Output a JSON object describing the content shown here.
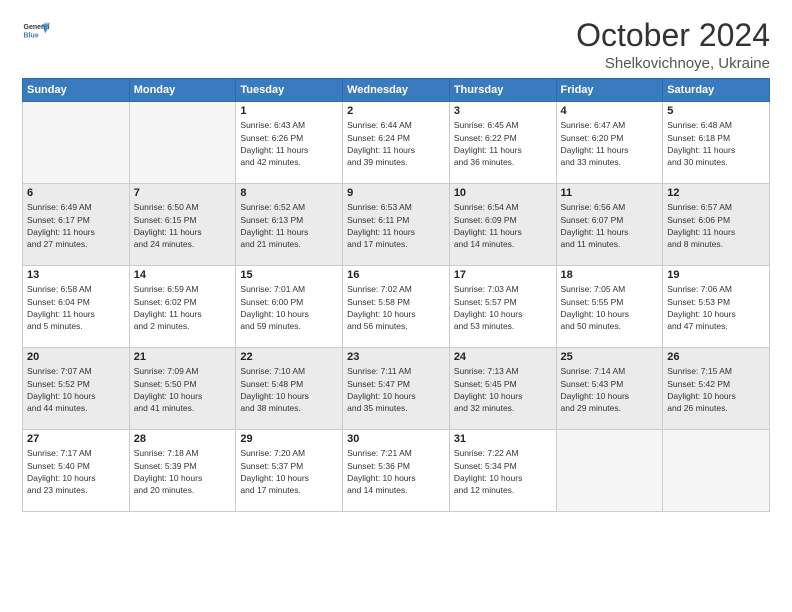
{
  "header": {
    "logo_line1": "General",
    "logo_line2": "Blue",
    "title": "October 2024",
    "subtitle": "Shelkovichnoye, Ukraine"
  },
  "days_of_week": [
    "Sunday",
    "Monday",
    "Tuesday",
    "Wednesday",
    "Thursday",
    "Friday",
    "Saturday"
  ],
  "weeks": [
    [
      {
        "day": "",
        "info": ""
      },
      {
        "day": "",
        "info": ""
      },
      {
        "day": "1",
        "info": "Sunrise: 6:43 AM\nSunset: 6:26 PM\nDaylight: 11 hours\nand 42 minutes."
      },
      {
        "day": "2",
        "info": "Sunrise: 6:44 AM\nSunset: 6:24 PM\nDaylight: 11 hours\nand 39 minutes."
      },
      {
        "day": "3",
        "info": "Sunrise: 6:45 AM\nSunset: 6:22 PM\nDaylight: 11 hours\nand 36 minutes."
      },
      {
        "day": "4",
        "info": "Sunrise: 6:47 AM\nSunset: 6:20 PM\nDaylight: 11 hours\nand 33 minutes."
      },
      {
        "day": "5",
        "info": "Sunrise: 6:48 AM\nSunset: 6:18 PM\nDaylight: 11 hours\nand 30 minutes."
      }
    ],
    [
      {
        "day": "6",
        "info": "Sunrise: 6:49 AM\nSunset: 6:17 PM\nDaylight: 11 hours\nand 27 minutes."
      },
      {
        "day": "7",
        "info": "Sunrise: 6:50 AM\nSunset: 6:15 PM\nDaylight: 11 hours\nand 24 minutes."
      },
      {
        "day": "8",
        "info": "Sunrise: 6:52 AM\nSunset: 6:13 PM\nDaylight: 11 hours\nand 21 minutes."
      },
      {
        "day": "9",
        "info": "Sunrise: 6:53 AM\nSunset: 6:11 PM\nDaylight: 11 hours\nand 17 minutes."
      },
      {
        "day": "10",
        "info": "Sunrise: 6:54 AM\nSunset: 6:09 PM\nDaylight: 11 hours\nand 14 minutes."
      },
      {
        "day": "11",
        "info": "Sunrise: 6:56 AM\nSunset: 6:07 PM\nDaylight: 11 hours\nand 11 minutes."
      },
      {
        "day": "12",
        "info": "Sunrise: 6:57 AM\nSunset: 6:06 PM\nDaylight: 11 hours\nand 8 minutes."
      }
    ],
    [
      {
        "day": "13",
        "info": "Sunrise: 6:58 AM\nSunset: 6:04 PM\nDaylight: 11 hours\nand 5 minutes."
      },
      {
        "day": "14",
        "info": "Sunrise: 6:59 AM\nSunset: 6:02 PM\nDaylight: 11 hours\nand 2 minutes."
      },
      {
        "day": "15",
        "info": "Sunrise: 7:01 AM\nSunset: 6:00 PM\nDaylight: 10 hours\nand 59 minutes."
      },
      {
        "day": "16",
        "info": "Sunrise: 7:02 AM\nSunset: 5:58 PM\nDaylight: 10 hours\nand 56 minutes."
      },
      {
        "day": "17",
        "info": "Sunrise: 7:03 AM\nSunset: 5:57 PM\nDaylight: 10 hours\nand 53 minutes."
      },
      {
        "day": "18",
        "info": "Sunrise: 7:05 AM\nSunset: 5:55 PM\nDaylight: 10 hours\nand 50 minutes."
      },
      {
        "day": "19",
        "info": "Sunrise: 7:06 AM\nSunset: 5:53 PM\nDaylight: 10 hours\nand 47 minutes."
      }
    ],
    [
      {
        "day": "20",
        "info": "Sunrise: 7:07 AM\nSunset: 5:52 PM\nDaylight: 10 hours\nand 44 minutes."
      },
      {
        "day": "21",
        "info": "Sunrise: 7:09 AM\nSunset: 5:50 PM\nDaylight: 10 hours\nand 41 minutes."
      },
      {
        "day": "22",
        "info": "Sunrise: 7:10 AM\nSunset: 5:48 PM\nDaylight: 10 hours\nand 38 minutes."
      },
      {
        "day": "23",
        "info": "Sunrise: 7:11 AM\nSunset: 5:47 PM\nDaylight: 10 hours\nand 35 minutes."
      },
      {
        "day": "24",
        "info": "Sunrise: 7:13 AM\nSunset: 5:45 PM\nDaylight: 10 hours\nand 32 minutes."
      },
      {
        "day": "25",
        "info": "Sunrise: 7:14 AM\nSunset: 5:43 PM\nDaylight: 10 hours\nand 29 minutes."
      },
      {
        "day": "26",
        "info": "Sunrise: 7:15 AM\nSunset: 5:42 PM\nDaylight: 10 hours\nand 26 minutes."
      }
    ],
    [
      {
        "day": "27",
        "info": "Sunrise: 7:17 AM\nSunset: 5:40 PM\nDaylight: 10 hours\nand 23 minutes."
      },
      {
        "day": "28",
        "info": "Sunrise: 7:18 AM\nSunset: 5:39 PM\nDaylight: 10 hours\nand 20 minutes."
      },
      {
        "day": "29",
        "info": "Sunrise: 7:20 AM\nSunset: 5:37 PM\nDaylight: 10 hours\nand 17 minutes."
      },
      {
        "day": "30",
        "info": "Sunrise: 7:21 AM\nSunset: 5:36 PM\nDaylight: 10 hours\nand 14 minutes."
      },
      {
        "day": "31",
        "info": "Sunrise: 7:22 AM\nSunset: 5:34 PM\nDaylight: 10 hours\nand 12 minutes."
      },
      {
        "day": "",
        "info": ""
      },
      {
        "day": "",
        "info": ""
      }
    ]
  ]
}
